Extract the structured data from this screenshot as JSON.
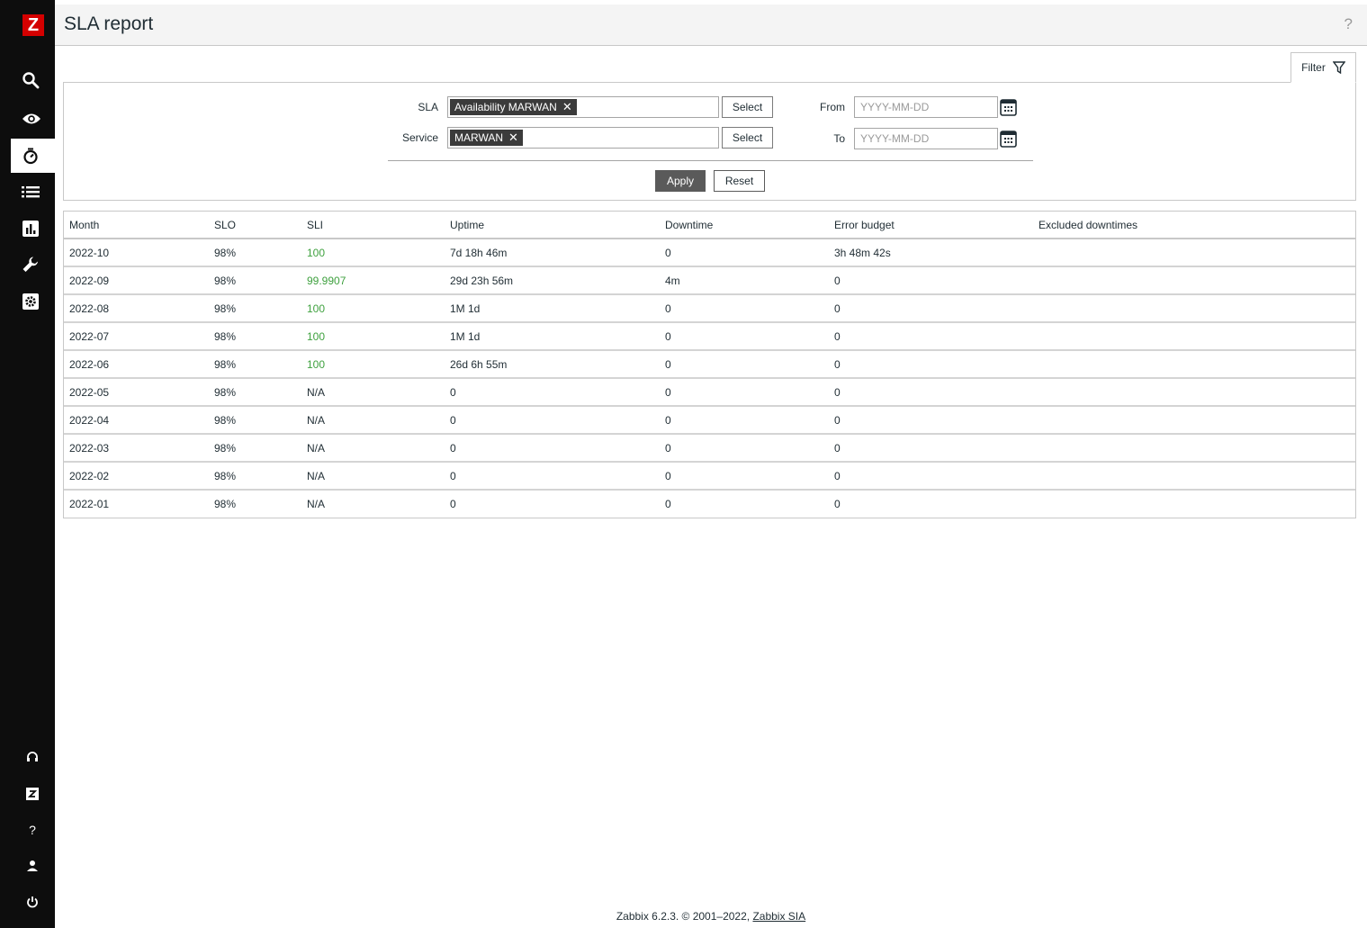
{
  "sidebar": {
    "logo": "Z",
    "items": [
      {
        "icon": "search-icon"
      },
      {
        "icon": "eye-icon"
      },
      {
        "icon": "stopwatch-icon"
      },
      {
        "icon": "list-icon"
      },
      {
        "icon": "chart-icon"
      },
      {
        "icon": "wrench-icon"
      },
      {
        "icon": "gear-icon"
      }
    ],
    "bottom_items": [
      {
        "icon": "support-icon"
      },
      {
        "icon": "zabbix-share-icon"
      },
      {
        "icon": "help-icon",
        "label": "?"
      },
      {
        "icon": "user-icon"
      },
      {
        "icon": "power-icon"
      }
    ]
  },
  "header": {
    "title": "SLA report",
    "help": "?"
  },
  "filter": {
    "tab_label": "Filter",
    "sla_label": "SLA",
    "sla_tag": "Availability MARWAN",
    "service_label": "Service",
    "service_tag": "MARWAN",
    "select_label": "Select",
    "from_label": "From",
    "to_label": "To",
    "date_placeholder": "YYYY-MM-DD",
    "apply_label": "Apply",
    "reset_label": "Reset"
  },
  "table": {
    "columns": [
      "Month",
      "SLO",
      "SLI",
      "Uptime",
      "Downtime",
      "Error budget",
      "Excluded downtimes"
    ],
    "rows": [
      {
        "month": "2022-10",
        "slo": "98%",
        "sli": "100",
        "uptime": "7d 18h 46m",
        "downtime": "0",
        "error_budget": "3h 48m 42s",
        "excluded": ""
      },
      {
        "month": "2022-09",
        "slo": "98%",
        "sli": "99.9907",
        "uptime": "29d 23h 56m",
        "downtime": "4m",
        "error_budget": "0",
        "excluded": ""
      },
      {
        "month": "2022-08",
        "slo": "98%",
        "sli": "100",
        "uptime": "1M 1d",
        "downtime": "0",
        "error_budget": "0",
        "excluded": ""
      },
      {
        "month": "2022-07",
        "slo": "98%",
        "sli": "100",
        "uptime": "1M 1d",
        "downtime": "0",
        "error_budget": "0",
        "excluded": ""
      },
      {
        "month": "2022-06",
        "slo": "98%",
        "sli": "100",
        "uptime": "26d 6h 55m",
        "downtime": "0",
        "error_budget": "0",
        "excluded": ""
      },
      {
        "month": "2022-05",
        "slo": "98%",
        "sli": "N/A",
        "uptime": "0",
        "downtime": "0",
        "error_budget": "0",
        "excluded": ""
      },
      {
        "month": "2022-04",
        "slo": "98%",
        "sli": "N/A",
        "uptime": "0",
        "downtime": "0",
        "error_budget": "0",
        "excluded": ""
      },
      {
        "month": "2022-03",
        "slo": "98%",
        "sli": "N/A",
        "uptime": "0",
        "downtime": "0",
        "error_budget": "0",
        "excluded": ""
      },
      {
        "month": "2022-02",
        "slo": "98%",
        "sli": "N/A",
        "uptime": "0",
        "downtime": "0",
        "error_budget": "0",
        "excluded": ""
      },
      {
        "month": "2022-01",
        "slo": "98%",
        "sli": "N/A",
        "uptime": "0",
        "downtime": "0",
        "error_budget": "0",
        "excluded": ""
      }
    ]
  },
  "footer": {
    "text": "Zabbix 6.2.3. © 2001–2022, ",
    "link": "Zabbix SIA"
  },
  "colors": {
    "sidebar_bg": "#0d0d0d",
    "logo_bg": "#d40000",
    "sli_ok": "#3fa13f",
    "tag_bg": "#3b3b3b",
    "apply_bg": "#5a5a5a"
  }
}
